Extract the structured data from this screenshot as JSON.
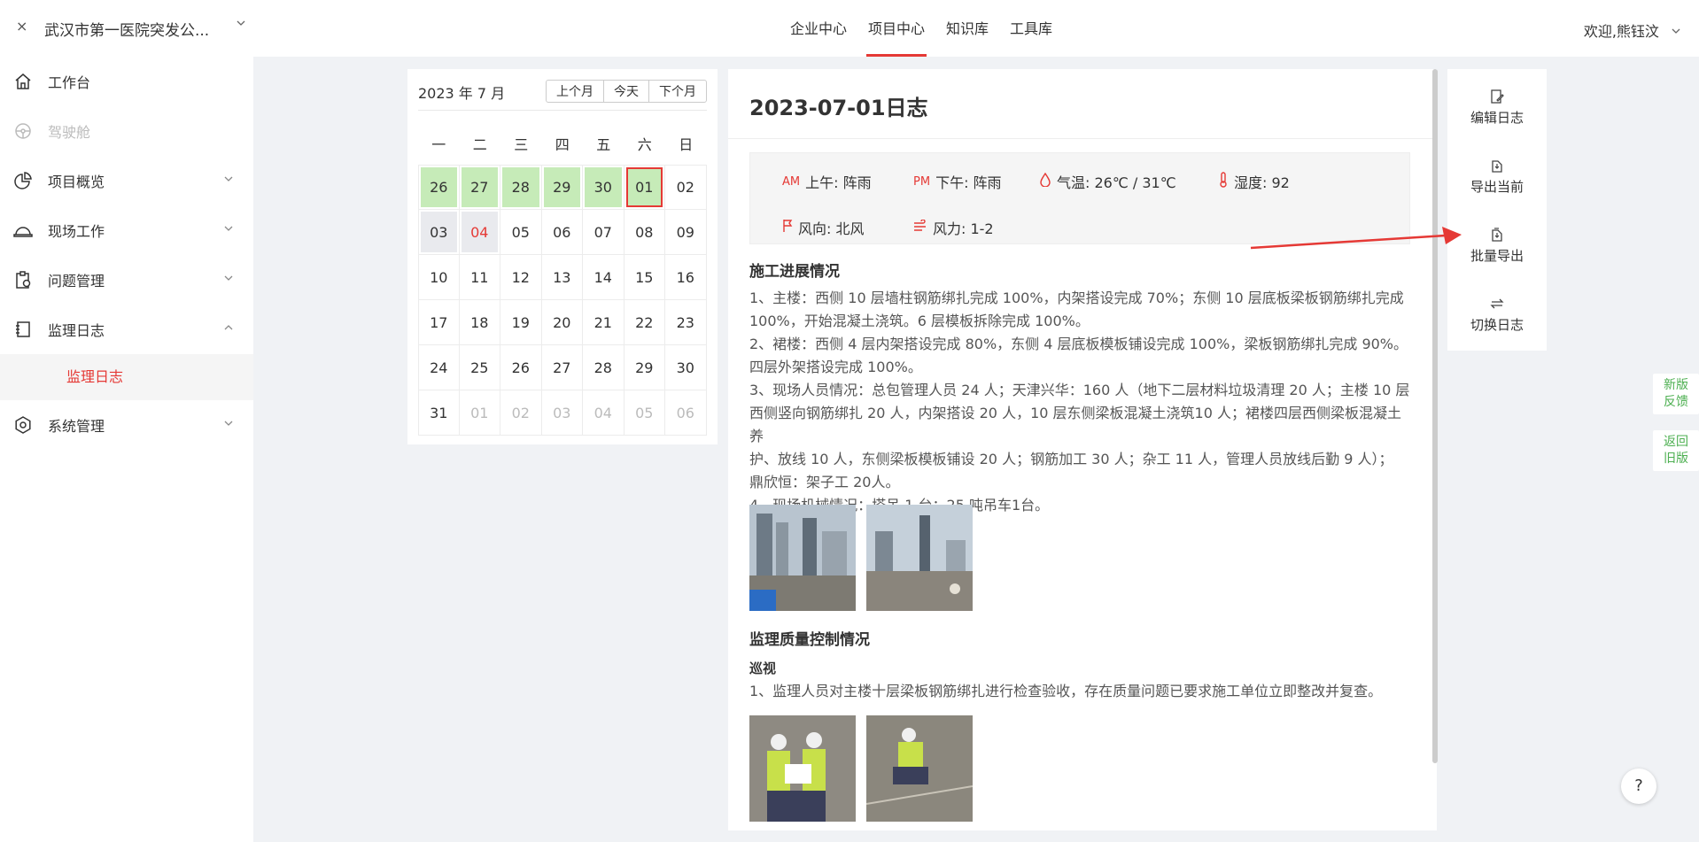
{
  "header": {
    "close": "×",
    "project_title": "武汉市第一医院突发公...",
    "nav": [
      "企业中心",
      "项目中心",
      "知识库",
      "工具库"
    ],
    "active_nav": "项目中心",
    "welcome": "欢迎,熊钰汶"
  },
  "sidebar": {
    "items": [
      {
        "label": "工作台",
        "icon": "home-icon"
      },
      {
        "label": "驾驶舱",
        "icon": "steering-wheel-icon"
      },
      {
        "label": "项目概览",
        "icon": "pie-chart-icon"
      },
      {
        "label": "现场工作",
        "icon": "hard-hat-icon"
      },
      {
        "label": "问题管理",
        "icon": "clipboard-check-icon"
      },
      {
        "label": "监理日志",
        "icon": "notebook-icon"
      },
      {
        "label": "系统管理",
        "icon": "gear-icon"
      }
    ],
    "sub_item": "监理日志"
  },
  "calendar": {
    "month_label": "2023 年 7 月",
    "prev": "上个月",
    "today": "今天",
    "next": "下个月",
    "weekdays": [
      "一",
      "二",
      "三",
      "四",
      "五",
      "六",
      "日"
    ],
    "days": [
      {
        "d": "26",
        "s": "green"
      },
      {
        "d": "27",
        "s": "green"
      },
      {
        "d": "28",
        "s": "green"
      },
      {
        "d": "29",
        "s": "green"
      },
      {
        "d": "30",
        "s": "green"
      },
      {
        "d": "01",
        "s": "sel"
      },
      {
        "d": "02",
        "s": ""
      },
      {
        "d": "03",
        "s": "gray"
      },
      {
        "d": "04",
        "s": "gray red"
      },
      {
        "d": "05",
        "s": ""
      },
      {
        "d": "06",
        "s": ""
      },
      {
        "d": "07",
        "s": ""
      },
      {
        "d": "08",
        "s": ""
      },
      {
        "d": "09",
        "s": ""
      },
      {
        "d": "10",
        "s": ""
      },
      {
        "d": "11",
        "s": ""
      },
      {
        "d": "12",
        "s": ""
      },
      {
        "d": "13",
        "s": ""
      },
      {
        "d": "14",
        "s": ""
      },
      {
        "d": "15",
        "s": ""
      },
      {
        "d": "16",
        "s": ""
      },
      {
        "d": "17",
        "s": ""
      },
      {
        "d": "18",
        "s": ""
      },
      {
        "d": "19",
        "s": ""
      },
      {
        "d": "20",
        "s": ""
      },
      {
        "d": "21",
        "s": ""
      },
      {
        "d": "22",
        "s": ""
      },
      {
        "d": "23",
        "s": ""
      },
      {
        "d": "24",
        "s": ""
      },
      {
        "d": "25",
        "s": ""
      },
      {
        "d": "26",
        "s": ""
      },
      {
        "d": "27",
        "s": ""
      },
      {
        "d": "28",
        "s": ""
      },
      {
        "d": "29",
        "s": ""
      },
      {
        "d": "30",
        "s": ""
      },
      {
        "d": "31",
        "s": ""
      },
      {
        "d": "01",
        "s": "dim"
      },
      {
        "d": "02",
        "s": "dim"
      },
      {
        "d": "03",
        "s": "dim"
      },
      {
        "d": "04",
        "s": "dim"
      },
      {
        "d": "05",
        "s": "dim"
      },
      {
        "d": "06",
        "s": "dim"
      }
    ]
  },
  "log": {
    "title": "2023-07-01日志",
    "weather": {
      "am_icon": "AM",
      "am": "上午: 阵雨",
      "pm_icon": "PM",
      "pm": "下午: 阵雨",
      "temp": "气温: 26℃ / 31℃",
      "humidity": "湿度: 92",
      "wind_dir": "风向: 北风",
      "wind_force": "风力: 1-2"
    },
    "progress_title": "施工进展情况",
    "progress_text": [
      "1、主楼：西侧 10 层墙柱钢筋绑扎完成 100%，内架搭设完成 70%；东侧 10 层底板梁板钢筋绑扎完成",
      "100%，开始混凝土浇筑。6 层模板拆除完成 100%。",
      "2、裙楼：西侧 4 层内架搭设完成 80%，东侧 4 层底板模板铺设完成 100%，梁板钢筋绑扎完成 90%。",
      "四层外架搭设完成 100%。",
      "3、现场人员情况：总包管理人员 24 人；天津兴华：160 人（地下二层材料垃圾清理 20 人；主楼 10 层",
      "西侧竖向钢筋绑扎 20 人，内架搭设 20 人，10 层东侧梁板混凝土浇筑10 人；裙楼四层西侧梁板混凝土养",
      "护、放线 10 人，东侧梁板模板铺设 20 人；钢筋加工 30 人；杂工 11 人，管理人员放线后勤 9 人）；",
      "鼎欣恒：架子工 20人。",
      "4、现场机械情况：塔吊 1 台；25 吨吊车1台。"
    ],
    "quality_title": "监理质量控制情况",
    "patrol_title": "巡视",
    "patrol_text": "1、监理人员对主楼十层梁板钢筋绑扎进行检查验收，存在质量问题已要求施工单位立即整改并复查。"
  },
  "actions": {
    "edit": "编辑日志",
    "export_current": "导出当前",
    "batch_export": "批量导出",
    "switch": "切换日志"
  },
  "feedback": {
    "new_version": [
      "新版",
      "反馈"
    ],
    "old_version": [
      "返回",
      "旧版"
    ]
  },
  "help": "?"
}
